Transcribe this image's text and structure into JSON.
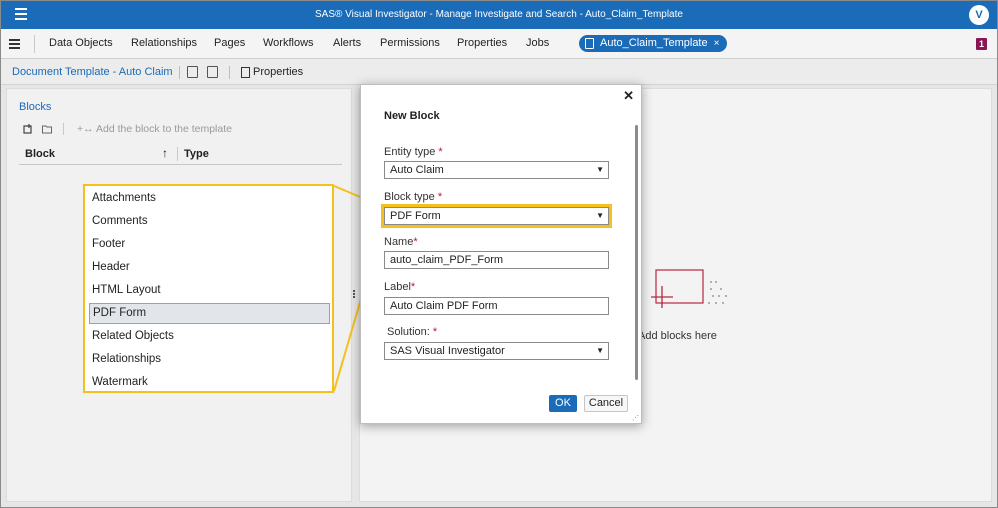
{
  "app": {
    "title": "SAS® Visual Investigator - Manage Investigate and Search - Auto_Claim_Template",
    "avatar_letter": "V",
    "brand_color": "#1a6bb8"
  },
  "nav": {
    "tabs": [
      "Data Objects",
      "Relationships",
      "Pages",
      "Workflows",
      "Alerts",
      "Permissions",
      "Properties",
      "Jobs"
    ],
    "open_doc": "Auto_Claim_Template",
    "open_doc_close": "×",
    "badge": "1"
  },
  "toolbar": {
    "document_title": "Document Template - Auto Claim",
    "properties_label": "Properties"
  },
  "blocks_panel": {
    "title": "Blocks",
    "add_block_label": "Add the block to the template",
    "add_block_icon": "+↔",
    "columns": {
      "block": "Block",
      "sort_arrow": "↑",
      "type": "Type"
    }
  },
  "canvas": {
    "placeholder": "Add blocks here"
  },
  "block_type_options": {
    "items": [
      "Attachments",
      "Comments",
      "Footer",
      "Header",
      "HTML Layout",
      "PDF Form",
      "Related Objects",
      "Relationships",
      "Watermark"
    ],
    "selected": "PDF Form",
    "highlight_color": "#f5bf1d"
  },
  "dialog": {
    "title": "New Block",
    "close": "✕",
    "entity_type": {
      "label": "Entity type",
      "value": "Auto Claim"
    },
    "block_type": {
      "label": "Block type",
      "value": "PDF Form"
    },
    "name": {
      "label": "Name",
      "value": "auto_claim_PDF_Form"
    },
    "label": {
      "label": "Label",
      "value": "Auto Claim PDF Form"
    },
    "solution": {
      "label": "Solution:",
      "value": "SAS Visual Investigator"
    },
    "required_mark": "*",
    "ok_label": "OK",
    "cancel_label": "Cancel"
  }
}
